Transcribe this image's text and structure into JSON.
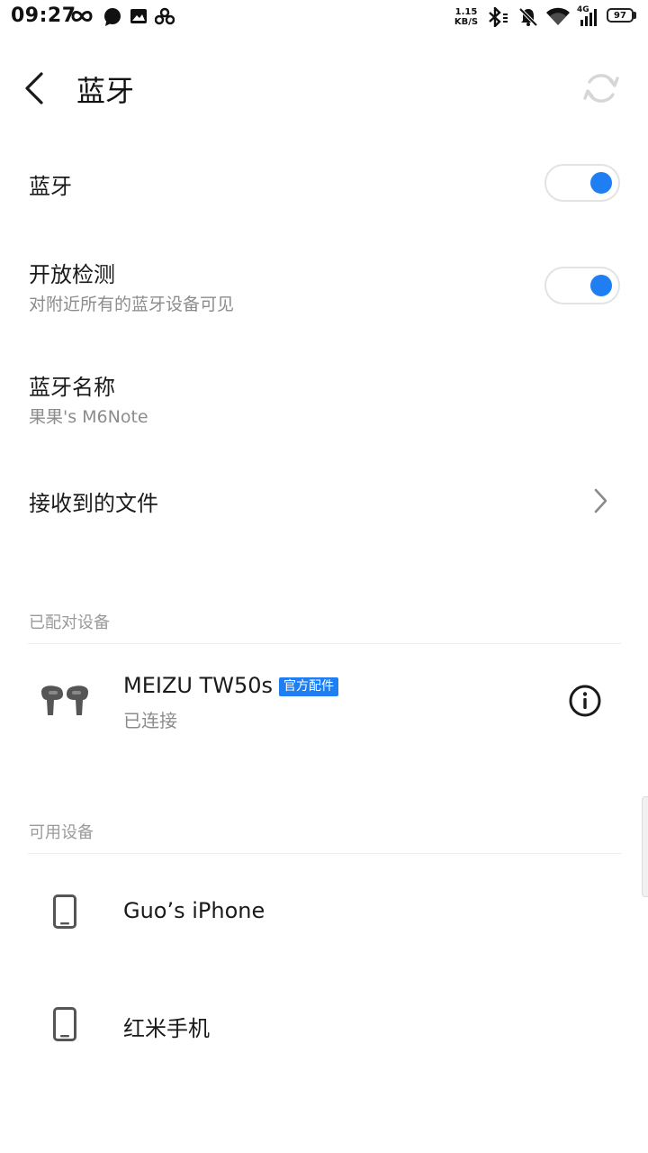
{
  "status_bar": {
    "time": "09:27",
    "net_speed_value": "1.15",
    "net_speed_unit": "KB/S",
    "network_label": "4G",
    "battery": "97"
  },
  "header": {
    "title": "蓝牙"
  },
  "settings": {
    "bluetooth": {
      "label": "蓝牙",
      "enabled": true
    },
    "discoverable": {
      "label": "开放检测",
      "description": "对附近所有的蓝牙设备可见",
      "enabled": true
    },
    "device_name": {
      "label": "蓝牙名称",
      "value": "果果's M6Note"
    },
    "received_files": {
      "label": "接收到的文件"
    }
  },
  "paired_section": {
    "label": "已配对设备",
    "devices": [
      {
        "name": "MEIZU TW50s",
        "badge": "官方配件",
        "status": "已连接",
        "icon": "earbuds-icon"
      }
    ]
  },
  "available_section": {
    "label": "可用设备",
    "devices": [
      {
        "name": "Guo’s iPhone",
        "icon": "phone-icon"
      },
      {
        "name": "红米手机",
        "icon": "phone-icon"
      }
    ]
  },
  "colors": {
    "accent": "#1f7ef2",
    "text_primary": "#1a1a1a",
    "text_secondary": "#8c8c8c"
  }
}
